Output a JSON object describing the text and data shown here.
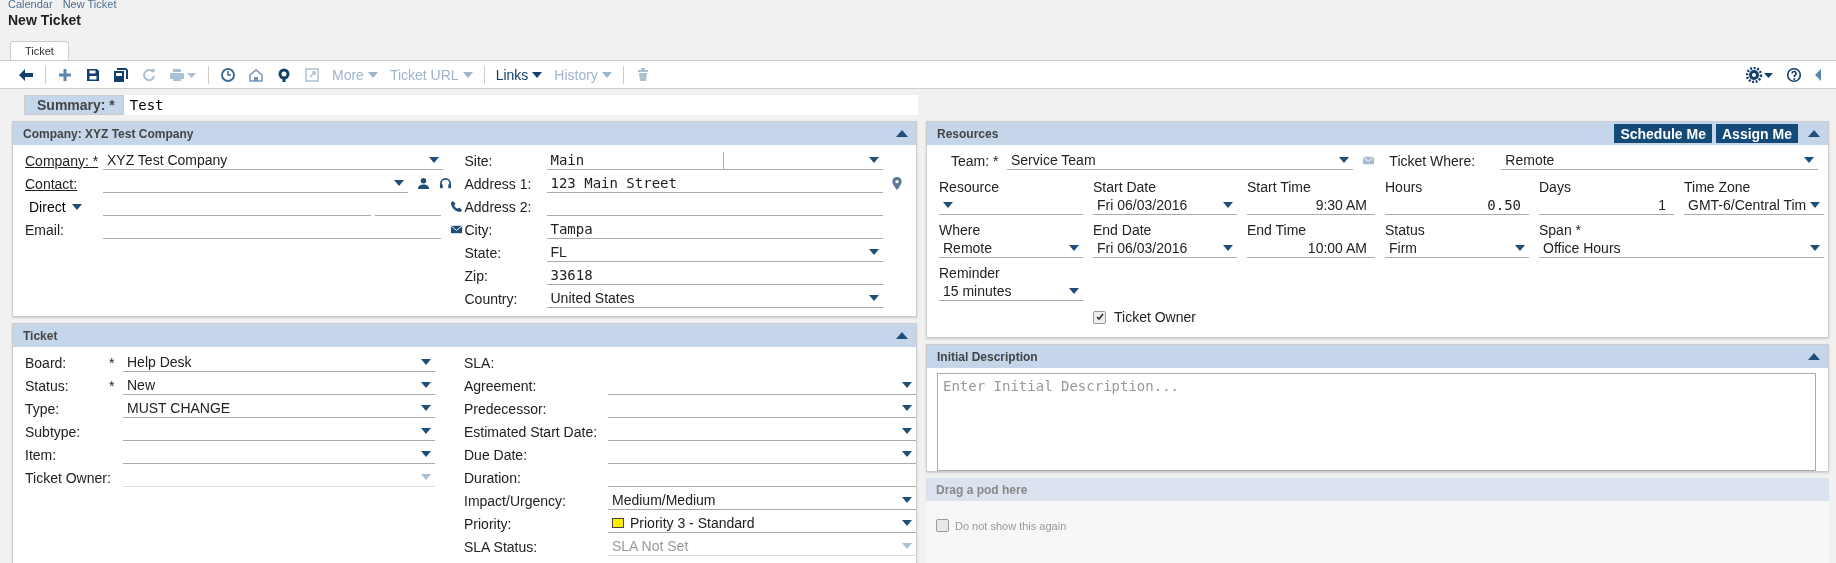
{
  "breadcrumb": [
    "Calendar",
    "New Ticket"
  ],
  "title": "New Ticket",
  "tabs": [
    {
      "label": "Ticket",
      "selected": true
    }
  ],
  "toolbar_menus": [
    {
      "label": "More",
      "disabled": true
    },
    {
      "label": "Ticket URL",
      "disabled": true
    },
    {
      "label": "Links",
      "disabled": false
    },
    {
      "label": "History",
      "disabled": true
    }
  ],
  "summary": {
    "label": "Summary:",
    "mark": "*",
    "value": "Test"
  },
  "company": {
    "title": "Company: XYZ Test Company",
    "company": {
      "label": "Company:",
      "mark": "*",
      "value": "XYZ Test Company"
    },
    "contact": {
      "label": "Contact:"
    },
    "phone": {
      "label": "Direct"
    },
    "email": {
      "label": "Email:"
    },
    "right": [
      {
        "label": "Site:",
        "kind": "combo",
        "value": "Main"
      },
      {
        "label": "Address 1:",
        "kind": "text",
        "value": "123 Main Street"
      },
      {
        "label": "Address 2:",
        "kind": "text"
      },
      {
        "label": "City:",
        "kind": "text",
        "value": "Tampa"
      },
      {
        "label": "State:",
        "kind": "select",
        "value": "FL"
      },
      {
        "label": "Zip:",
        "kind": "text",
        "value": "33618"
      },
      {
        "label": "Country:",
        "kind": "select",
        "value": "United States"
      }
    ]
  },
  "ticket": {
    "title": "Ticket",
    "left": [
      {
        "label": "Board:",
        "mark": "*",
        "kind": "select",
        "value": "Help Desk",
        "disabled": false
      },
      {
        "label": "Status:",
        "mark": "*",
        "kind": "select",
        "value": "New",
        "disabled": false
      },
      {
        "label": "Type:",
        "kind": "select",
        "value": "MUST CHANGE",
        "disabled": false
      },
      {
        "label": "Subtype:",
        "kind": "select",
        "disabled": false
      },
      {
        "label": "Item:",
        "kind": "select",
        "disabled": false
      },
      {
        "label": "Ticket Owner:",
        "kind": "select",
        "disabled": true
      }
    ],
    "right": [
      {
        "label": "SLA:",
        "kind": "none"
      },
      {
        "label": "Agreement:",
        "kind": "select",
        "disabled": false
      },
      {
        "label": "Predecessor:",
        "kind": "select",
        "disabled": false
      },
      {
        "label": "Estimated Start Date:",
        "kind": "select",
        "disabled": false
      },
      {
        "label": "Due Date:",
        "kind": "select",
        "disabled": false
      },
      {
        "label": "Duration:",
        "kind": "text"
      },
      {
        "label": "Impact/Urgency:",
        "kind": "select",
        "value": "Medium/Medium",
        "disabled": false
      },
      {
        "label": "Priority:",
        "kind": "select",
        "value": "Priority 3 - Standard",
        "disabled": false,
        "color": "#ffee00"
      },
      {
        "label": "SLA Status:",
        "kind": "select",
        "value": "SLA Not Set",
        "disabled": true
      }
    ]
  },
  "resources": {
    "title": "Resources",
    "buttons": [
      "Schedule Me",
      "Assign Me"
    ],
    "team": {
      "label": "Team:",
      "mark": "*",
      "value": "Service Team"
    },
    "ticket_where": {
      "label": "Ticket Where:",
      "value": "Remote"
    },
    "rows": [
      [
        {
          "label": "Resource",
          "kind": "select"
        },
        {
          "label": "Start Date",
          "kind": "select",
          "value": "Fri 06/03/2016"
        },
        {
          "label": "Start Time",
          "kind": "time",
          "value": "9:30 AM"
        },
        {
          "label": "Hours",
          "kind": "number",
          "value": "0.50"
        },
        {
          "label": "Days",
          "kind": "time",
          "value": "1"
        },
        {
          "label": "Time Zone",
          "kind": "select",
          "value": "GMT-6/Central Tim"
        }
      ],
      [
        {
          "label": "Where",
          "kind": "select",
          "value": "Remote"
        },
        {
          "label": "End Date",
          "kind": "select",
          "value": "Fri 06/03/2016"
        },
        {
          "label": "End Time",
          "kind": "time",
          "value": "10:00 AM"
        },
        {
          "label": "Status",
          "kind": "select",
          "value": "Firm"
        },
        {
          "label": "Span *",
          "kind": "select",
          "value": "Office Hours"
        }
      ],
      [
        {
          "label": "Reminder",
          "kind": "select",
          "value": "15 minutes"
        }
      ]
    ],
    "owner": {
      "label": "Ticket Owner",
      "checked": true
    }
  },
  "description": {
    "title": "Initial Description",
    "placeholder": "Enter Initial Description..."
  },
  "pod": {
    "title": "Drag a pod here",
    "checkbox": {
      "label": "Do not show this again",
      "checked": false
    }
  }
}
